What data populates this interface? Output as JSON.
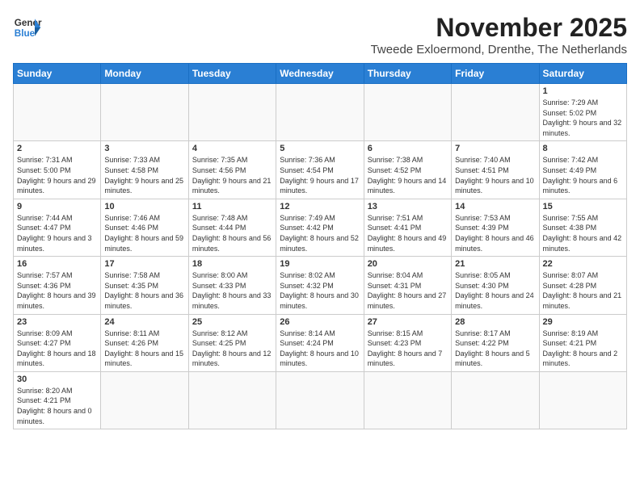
{
  "header": {
    "logo_general": "General",
    "logo_blue": "Blue",
    "month_title": "November 2025",
    "subtitle": "Tweede Exloermond, Drenthe, The Netherlands"
  },
  "weekdays": [
    "Sunday",
    "Monday",
    "Tuesday",
    "Wednesday",
    "Thursday",
    "Friday",
    "Saturday"
  ],
  "weeks": [
    [
      {
        "day": "",
        "info": ""
      },
      {
        "day": "",
        "info": ""
      },
      {
        "day": "",
        "info": ""
      },
      {
        "day": "",
        "info": ""
      },
      {
        "day": "",
        "info": ""
      },
      {
        "day": "",
        "info": ""
      },
      {
        "day": "1",
        "info": "Sunrise: 7:29 AM\nSunset: 5:02 PM\nDaylight: 9 hours and 32 minutes."
      }
    ],
    [
      {
        "day": "2",
        "info": "Sunrise: 7:31 AM\nSunset: 5:00 PM\nDaylight: 9 hours and 29 minutes."
      },
      {
        "day": "3",
        "info": "Sunrise: 7:33 AM\nSunset: 4:58 PM\nDaylight: 9 hours and 25 minutes."
      },
      {
        "day": "4",
        "info": "Sunrise: 7:35 AM\nSunset: 4:56 PM\nDaylight: 9 hours and 21 minutes."
      },
      {
        "day": "5",
        "info": "Sunrise: 7:36 AM\nSunset: 4:54 PM\nDaylight: 9 hours and 17 minutes."
      },
      {
        "day": "6",
        "info": "Sunrise: 7:38 AM\nSunset: 4:52 PM\nDaylight: 9 hours and 14 minutes."
      },
      {
        "day": "7",
        "info": "Sunrise: 7:40 AM\nSunset: 4:51 PM\nDaylight: 9 hours and 10 minutes."
      },
      {
        "day": "8",
        "info": "Sunrise: 7:42 AM\nSunset: 4:49 PM\nDaylight: 9 hours and 6 minutes."
      }
    ],
    [
      {
        "day": "9",
        "info": "Sunrise: 7:44 AM\nSunset: 4:47 PM\nDaylight: 9 hours and 3 minutes."
      },
      {
        "day": "10",
        "info": "Sunrise: 7:46 AM\nSunset: 4:46 PM\nDaylight: 8 hours and 59 minutes."
      },
      {
        "day": "11",
        "info": "Sunrise: 7:48 AM\nSunset: 4:44 PM\nDaylight: 8 hours and 56 minutes."
      },
      {
        "day": "12",
        "info": "Sunrise: 7:49 AM\nSunset: 4:42 PM\nDaylight: 8 hours and 52 minutes."
      },
      {
        "day": "13",
        "info": "Sunrise: 7:51 AM\nSunset: 4:41 PM\nDaylight: 8 hours and 49 minutes."
      },
      {
        "day": "14",
        "info": "Sunrise: 7:53 AM\nSunset: 4:39 PM\nDaylight: 8 hours and 46 minutes."
      },
      {
        "day": "15",
        "info": "Sunrise: 7:55 AM\nSunset: 4:38 PM\nDaylight: 8 hours and 42 minutes."
      }
    ],
    [
      {
        "day": "16",
        "info": "Sunrise: 7:57 AM\nSunset: 4:36 PM\nDaylight: 8 hours and 39 minutes."
      },
      {
        "day": "17",
        "info": "Sunrise: 7:58 AM\nSunset: 4:35 PM\nDaylight: 8 hours and 36 minutes."
      },
      {
        "day": "18",
        "info": "Sunrise: 8:00 AM\nSunset: 4:33 PM\nDaylight: 8 hours and 33 minutes."
      },
      {
        "day": "19",
        "info": "Sunrise: 8:02 AM\nSunset: 4:32 PM\nDaylight: 8 hours and 30 minutes."
      },
      {
        "day": "20",
        "info": "Sunrise: 8:04 AM\nSunset: 4:31 PM\nDaylight: 8 hours and 27 minutes."
      },
      {
        "day": "21",
        "info": "Sunrise: 8:05 AM\nSunset: 4:30 PM\nDaylight: 8 hours and 24 minutes."
      },
      {
        "day": "22",
        "info": "Sunrise: 8:07 AM\nSunset: 4:28 PM\nDaylight: 8 hours and 21 minutes."
      }
    ],
    [
      {
        "day": "23",
        "info": "Sunrise: 8:09 AM\nSunset: 4:27 PM\nDaylight: 8 hours and 18 minutes."
      },
      {
        "day": "24",
        "info": "Sunrise: 8:11 AM\nSunset: 4:26 PM\nDaylight: 8 hours and 15 minutes."
      },
      {
        "day": "25",
        "info": "Sunrise: 8:12 AM\nSunset: 4:25 PM\nDaylight: 8 hours and 12 minutes."
      },
      {
        "day": "26",
        "info": "Sunrise: 8:14 AM\nSunset: 4:24 PM\nDaylight: 8 hours and 10 minutes."
      },
      {
        "day": "27",
        "info": "Sunrise: 8:15 AM\nSunset: 4:23 PM\nDaylight: 8 hours and 7 minutes."
      },
      {
        "day": "28",
        "info": "Sunrise: 8:17 AM\nSunset: 4:22 PM\nDaylight: 8 hours and 5 minutes."
      },
      {
        "day": "29",
        "info": "Sunrise: 8:19 AM\nSunset: 4:21 PM\nDaylight: 8 hours and 2 minutes."
      }
    ],
    [
      {
        "day": "30",
        "info": "Sunrise: 8:20 AM\nSunset: 4:21 PM\nDaylight: 8 hours and 0 minutes."
      },
      {
        "day": "",
        "info": ""
      },
      {
        "day": "",
        "info": ""
      },
      {
        "day": "",
        "info": ""
      },
      {
        "day": "",
        "info": ""
      },
      {
        "day": "",
        "info": ""
      },
      {
        "day": "",
        "info": ""
      }
    ]
  ]
}
